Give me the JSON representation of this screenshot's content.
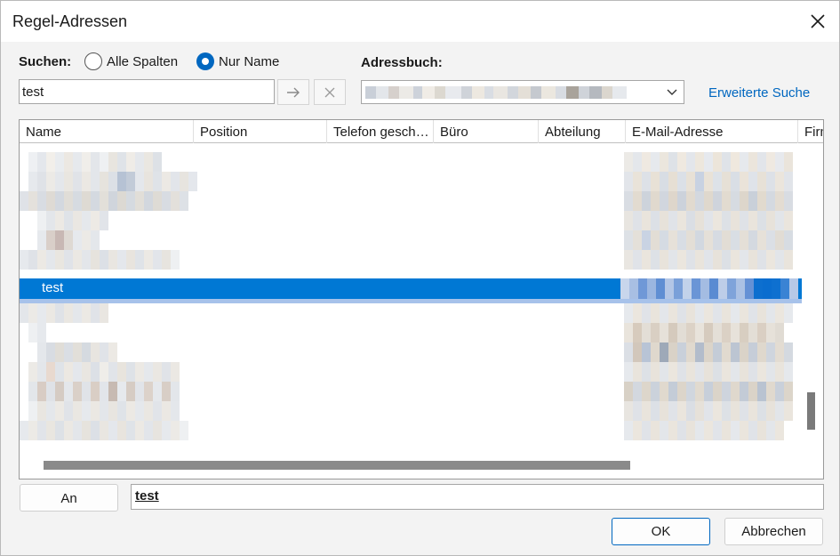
{
  "window": {
    "title": "Regel-Adressen"
  },
  "search": {
    "label": "Suchen:",
    "option_all": "Alle Spalten",
    "option_name": "Nur Name",
    "selected": "Nur Name",
    "value": "test"
  },
  "addressbook": {
    "label": "Adressbuch:"
  },
  "advanced_search": "Erweiterte Suche",
  "columns": [
    "Name",
    "Position",
    "Telefon gesch…",
    "Büro",
    "Abteilung",
    "E-Mail-Adresse",
    "Firm"
  ],
  "selected_row": {
    "name": "test"
  },
  "to_button": "An",
  "to_value": "test",
  "buttons": {
    "ok": "OK",
    "cancel": "Abbrechen"
  },
  "colors": {
    "accent": "#0078d4",
    "link": "#0067c0"
  }
}
